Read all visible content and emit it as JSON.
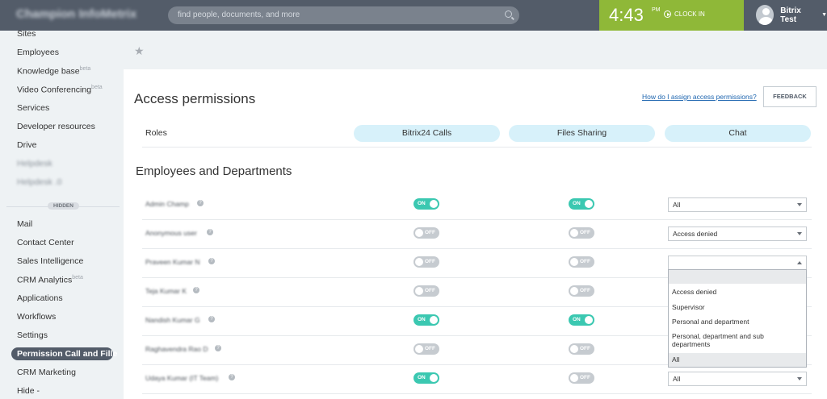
{
  "header": {
    "logo": "Champion InfoMetrix",
    "search_placeholder": "find people, documents, and more",
    "clock_time": "4:43",
    "clock_ampm": "PM",
    "clock_in": "CLOCK IN",
    "user_name": "Bitrix Test"
  },
  "sidebar": {
    "items": [
      {
        "label": "Sites",
        "sup": ""
      },
      {
        "label": "Employees",
        "sup": ""
      },
      {
        "label": "Knowledge base",
        "sup": "beta"
      },
      {
        "label": "Video Conferencing",
        "sup": "beta"
      },
      {
        "label": "Services",
        "sup": ""
      },
      {
        "label": "Developer resources",
        "sup": ""
      },
      {
        "label": "Drive",
        "sup": ""
      },
      {
        "label": "Helpdesk",
        "sup": ""
      },
      {
        "label": "Helpdesk .0",
        "sup": ""
      }
    ],
    "hidden_label": "HIDDEN",
    "hidden_items": [
      {
        "label": "Mail",
        "sup": ""
      },
      {
        "label": "Contact Center",
        "sup": ""
      },
      {
        "label": "Sales Intelligence",
        "sup": ""
      },
      {
        "label": "CRM Analytics",
        "sup": "beta"
      },
      {
        "label": "Applications",
        "sup": ""
      },
      {
        "label": "Workflows",
        "sup": ""
      },
      {
        "label": "Settings",
        "sup": ""
      }
    ],
    "active_item": "Permission Call and Fille",
    "after_items": [
      {
        "label": "CRM Marketing"
      },
      {
        "label": "Hide -"
      }
    ]
  },
  "page": {
    "title": "Access permissions",
    "help_link": "How do I assign access permissions?",
    "feedback": "FEEDBACK",
    "roles_label": "Roles",
    "roles": [
      "Bitrix24 Calls",
      "Files Sharing",
      "Chat"
    ],
    "section_title": "Employees and Departments"
  },
  "employees": [
    {
      "name": "Admin Champ",
      "calls": "ON",
      "files": "ON",
      "chat": "All"
    },
    {
      "name": "Anonymous user",
      "calls": "OFF",
      "files": "OFF",
      "chat": "Access denied"
    },
    {
      "name": "Praveen Kumar N",
      "calls": "OFF",
      "files": "OFF",
      "chat": ""
    },
    {
      "name": "Teja Kumar K",
      "calls": "OFF",
      "files": "OFF",
      "chat": ""
    },
    {
      "name": "Nandish Kumar G",
      "calls": "ON",
      "files": "ON",
      "chat": ""
    },
    {
      "name": "Raghavendra Rao D",
      "calls": "OFF",
      "files": "OFF",
      "chat": ""
    },
    {
      "name": "Udaya Kumar (IT Team)",
      "calls": "ON",
      "files": "OFF",
      "chat": "All"
    }
  ],
  "dropdown_options": [
    "",
    "Access denied",
    "Supervisor",
    "Personal and department",
    "Personal, department and sub departments",
    "All"
  ],
  "dropdown_selected": "All"
}
